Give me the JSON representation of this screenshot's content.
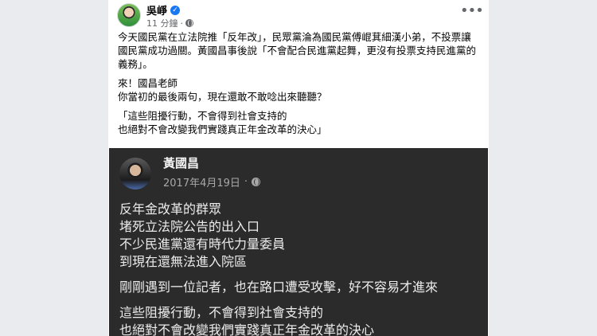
{
  "post": {
    "author": "吳崢",
    "time": "11 分鐘",
    "paragraphs": [
      "今天國民黨在立法院推「反年改」，民眾黨淪為國民黨傅崐萁細漢小弟，不投票讓國民黨成功過關。黃國昌事後說「不會配合民進黨起舞，更沒有投票支持民進黨的義務」。",
      "來！國昌老師\n你當初的最後兩句，現在還敢不敢唸出來聽聽？",
      "「這些阻擾行動，不會得到社會支持的\n也絕對不會改變我們實踐真正年金改革的決心」"
    ]
  },
  "embed": {
    "author": "黃國昌",
    "date": "2017年4月19日",
    "paragraphs": [
      "反年金改革的群眾\n堵死立法院公告的出入口\n不少民進黨還有時代力量委員\n到現在還無法進入院區",
      "剛剛遇到一位記者，也在路口遭受攻擊，好不容易才進來",
      "這些阻擾行動，不會得到社會支持的\n也絕對不會改變我們實踐真正年金改革的決心"
    ]
  },
  "icons": {
    "verified": "verified-badge-icon",
    "audience": "globe-icon",
    "more": "more-options-icon"
  },
  "colors": {
    "verified_blue": "#1877f2",
    "embed_background": "#2b2b2b"
  }
}
